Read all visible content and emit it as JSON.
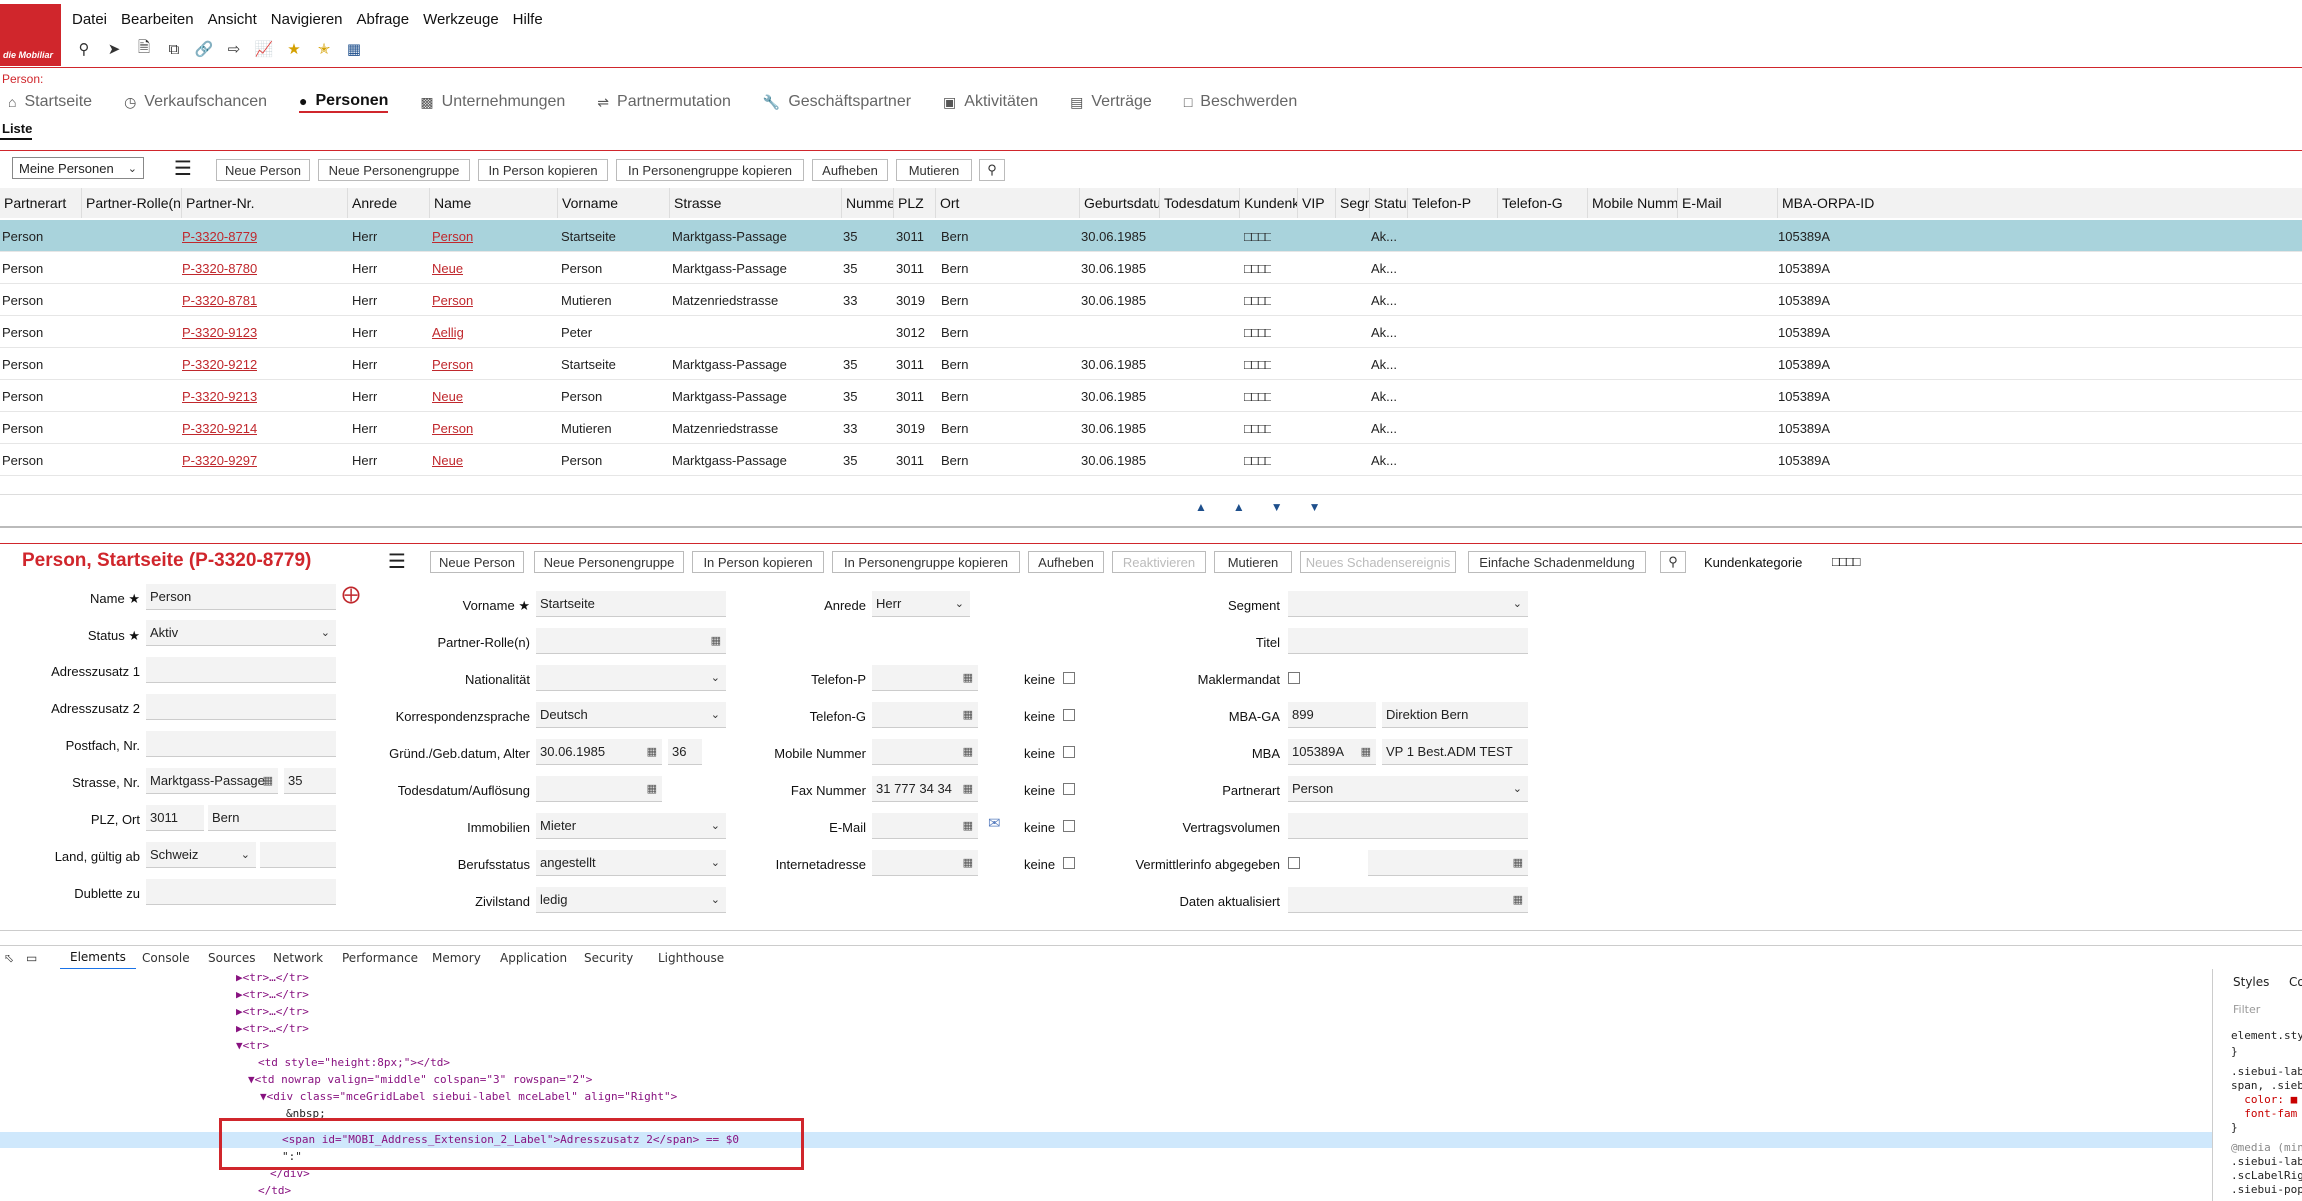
{
  "logo_text": "die Mobiliar",
  "menu": [
    "Datei",
    "Bearbeiten",
    "Ansicht",
    "Navigieren",
    "Abfrage",
    "Werkzeuge",
    "Hilfe"
  ],
  "toolbar_icons": [
    "search-icon",
    "forward-icon",
    "document-icon",
    "copy-icon",
    "link-icon",
    "export-icon",
    "chart-icon",
    "star-icon",
    "star-add-icon",
    "table-icon"
  ],
  "breadcrumb": "Person:",
  "tabs": [
    {
      "label": "Startseite",
      "icon": "home-icon"
    },
    {
      "label": "Verkaufschancen",
      "icon": "clock-icon"
    },
    {
      "label": "Personen",
      "icon": "person-icon",
      "active": true
    },
    {
      "label": "Unternehmungen",
      "icon": "building-icon"
    },
    {
      "label": "Partnermutation",
      "icon": "arrows-icon"
    },
    {
      "label": "Geschäftspartner",
      "icon": "wrench-icon"
    },
    {
      "label": "Aktivitäten",
      "icon": "calendar-icon"
    },
    {
      "label": "Verträge",
      "icon": "contract-icon"
    },
    {
      "label": "Beschwerden",
      "icon": "comment-icon"
    }
  ],
  "subtab": "Liste",
  "list": {
    "filter": "Meine Personen",
    "buttons": [
      "Neue Person",
      "Neue Personengruppe",
      "In Person kopieren",
      "In Personengruppe kopieren",
      "Aufheben",
      "Mutieren"
    ],
    "columns": [
      "Partnerart",
      "Partner-Rolle(n)",
      "Partner-Nr.",
      "Anrede",
      "Name",
      "Vorname",
      "Strasse",
      "Nummer",
      "PLZ",
      "Ort",
      "Geburtsdatum",
      "Todesdatum",
      "Kundenkategorie",
      "VIP",
      "Segment",
      "Status",
      "Telefon-P",
      "Telefon-G",
      "Mobile Nummer",
      "E-Mail",
      "MBA-ORPA-ID"
    ],
    "rows": [
      {
        "partnerart": "Person",
        "nr": "P-3320-8779",
        "anrede": "Herr",
        "name": "Person",
        "vorname": "Startseite",
        "strasse": "Marktgass-Passage",
        "nummer": "35",
        "plz": "3011",
        "ort": "Bern",
        "geb": "30.06.1985",
        "kk": "□□□□",
        "status": "Ak...",
        "mba": "105389A"
      },
      {
        "partnerart": "Person",
        "nr": "P-3320-8780",
        "anrede": "Herr",
        "name": "Neue",
        "vorname": "Person",
        "strasse": "Marktgass-Passage",
        "nummer": "35",
        "plz": "3011",
        "ort": "Bern",
        "geb": "30.06.1985",
        "kk": "□□□□",
        "status": "Ak...",
        "mba": "105389A"
      },
      {
        "partnerart": "Person",
        "nr": "P-3320-8781",
        "anrede": "Herr",
        "name": "Person",
        "vorname": "Mutieren",
        "strasse": "Matzenriedstrasse",
        "nummer": "33",
        "plz": "3019",
        "ort": "Bern",
        "geb": "30.06.1985",
        "kk": "□□□□",
        "status": "Ak...",
        "mba": "105389A"
      },
      {
        "partnerart": "Person",
        "nr": "P-3320-9123",
        "anrede": "Herr",
        "name": "Aellig",
        "vorname": "Peter",
        "strasse": "",
        "nummer": "",
        "plz": "3012",
        "ort": "Bern",
        "geb": "",
        "kk": "□□□□",
        "status": "Ak...",
        "mba": "105389A"
      },
      {
        "partnerart": "Person",
        "nr": "P-3320-9212",
        "anrede": "Herr",
        "name": "Person",
        "vorname": "Startseite",
        "strasse": "Marktgass-Passage",
        "nummer": "35",
        "plz": "3011",
        "ort": "Bern",
        "geb": "30.06.1985",
        "kk": "□□□□",
        "status": "Ak...",
        "mba": "105389A"
      },
      {
        "partnerart": "Person",
        "nr": "P-3320-9213",
        "anrede": "Herr",
        "name": "Neue",
        "vorname": "Person",
        "strasse": "Marktgass-Passage",
        "nummer": "35",
        "plz": "3011",
        "ort": "Bern",
        "geb": "30.06.1985",
        "kk": "□□□□",
        "status": "Ak...",
        "mba": "105389A"
      },
      {
        "partnerart": "Person",
        "nr": "P-3320-9214",
        "anrede": "Herr",
        "name": "Person",
        "vorname": "Mutieren",
        "strasse": "Matzenriedstrasse",
        "nummer": "33",
        "plz": "3019",
        "ort": "Bern",
        "geb": "30.06.1985",
        "kk": "□□□□",
        "status": "Ak...",
        "mba": "105389A"
      },
      {
        "partnerart": "Person",
        "nr": "P-3320-9297",
        "anrede": "Herr",
        "name": "Neue",
        "vorname": "Person",
        "strasse": "Marktgass-Passage",
        "nummer": "35",
        "plz": "3011",
        "ort": "Bern",
        "geb": "30.06.1985",
        "kk": "□□□□",
        "status": "Ak...",
        "mba": "105389A"
      }
    ]
  },
  "detail": {
    "title": "Person, Startseite (P-3320-8779)",
    "buttons": [
      "Neue Person",
      "Neue Personengruppe",
      "In Person kopieren",
      "In Personengruppe kopieren",
      "Aufheben",
      "Reaktivieren",
      "Mutieren",
      "Neues Schadensereignis",
      "Einfache Schadenmeldung"
    ],
    "kundenkategorie_label": "Kundenkategorie",
    "kundenkategorie_value": "□□□□",
    "col1": {
      "name_label": "Name",
      "name": "Person",
      "status_label": "Status",
      "status": "Aktiv",
      "adresszusatz1_label": "Adresszusatz 1",
      "adresszusatz2_label": "Adresszusatz 2",
      "postfach_label": "Postfach, Nr.",
      "strasse_label": "Strasse, Nr.",
      "strasse": "Marktgass-Passage",
      "nummer": "35",
      "plz_label": "PLZ, Ort",
      "plz": "3011",
      "ort": "Bern",
      "land_label": "Land, gültig ab",
      "land": "Schweiz",
      "dublette_label": "Dublette zu"
    },
    "col2": {
      "vorname_label": "Vorname",
      "vorname": "Startseite",
      "rolle_label": "Partner-Rolle(n)",
      "nationalitaet_label": "Nationalität",
      "korrespondenz_label": "Korrespondenzsprache",
      "korrespondenz": "Deutsch",
      "geb_label": "Gründ./Geb.datum, Alter",
      "geb": "30.06.1985",
      "alter": "36",
      "tod_label": "Todesdatum/Auflösung",
      "immobilien_label": "Immobilien",
      "immobilien": "Mieter",
      "beruf_label": "Berufsstatus",
      "beruf": "angestellt",
      "zivil_label": "Zivilstand",
      "zivil": "ledig"
    },
    "col3": {
      "anrede_label": "Anrede",
      "anrede": "Herr",
      "telp_label": "Telefon-P",
      "telg_label": "Telefon-G",
      "mobile_label": "Mobile Nummer",
      "fax_label": "Fax Nummer",
      "fax": "31 777 34 34",
      "email_label": "E-Mail",
      "internet_label": "Internetadresse",
      "keine": "keine"
    },
    "col4": {
      "segment_label": "Segment",
      "titel_label": "Titel",
      "makler_label": "Maklermandat",
      "mbaga_label": "MBA-GA",
      "mbaga": "899",
      "mbaga_name": "Direktion Bern",
      "mba_label": "MBA",
      "mba": "105389A",
      "mba_name": "VP 1 Best.ADM TEST",
      "partnerart_label": "Partnerart",
      "partnerart": "Person",
      "vertragsvolumen_label": "Vertragsvolumen",
      "vermittler_label": "Vermittlerinfo abgegeben",
      "daten_label": "Daten aktualisiert"
    }
  },
  "devtools": {
    "tabs": [
      "Elements",
      "Console",
      "Sources",
      "Network",
      "Performance",
      "Memory",
      "Application",
      "Security",
      "Lighthouse"
    ],
    "lines": [
      "▶<tr>…</tr>",
      "▶<tr>…</tr>",
      "▶<tr>…</tr>",
      "▶<tr>…</tr>",
      "▼<tr>",
      "<td style=\"height:8px;\"></td>",
      "▼<td nowrap valign=\"middle\" colspan=\"3\" rowspan=\"2\">",
      "▼<div class=\"mceGridLabel siebui-label mceLabel\" align=\"Right\">",
      "&nbsp;",
      "<span id=\"MOBI_Address_Extension_2_Label\">Adresszusatz 2</span> == $0",
      "\":\"",
      "</div>",
      "</td>"
    ],
    "styles_tab": "Styles",
    "styles_tab2": "Co",
    "filter": "Filter",
    "styles_lines": [
      "element.sty",
      "}",
      ".siebui-lab",
      "span, .sieb",
      "  color: ■",
      "  font-fam",
      "}",
      "@media (min",
      ".siebui-lab",
      ".scLabelRig",
      ".siebui-pop"
    ]
  }
}
